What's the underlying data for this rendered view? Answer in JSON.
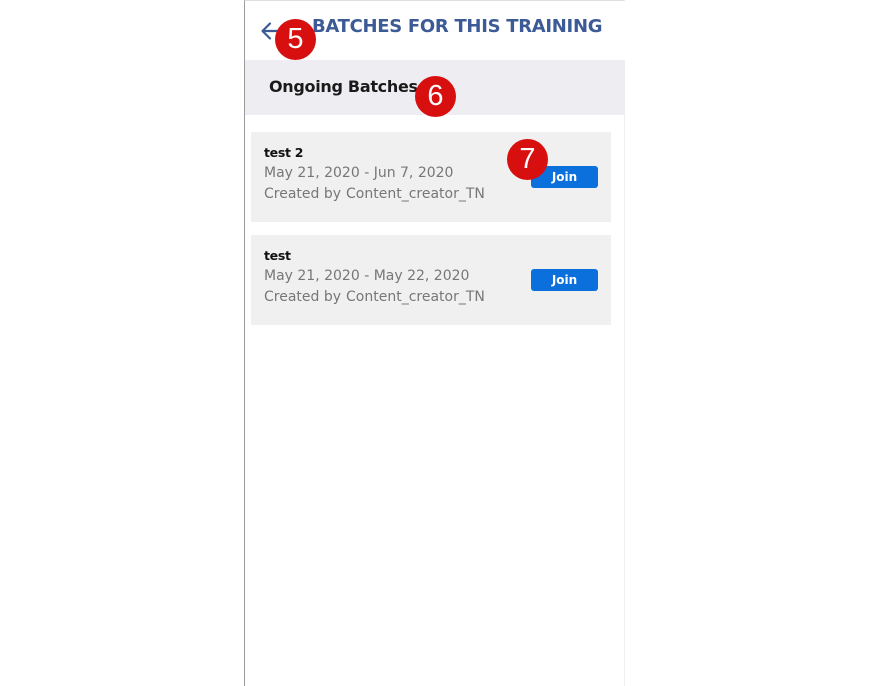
{
  "header": {
    "title": "BATCHES FOR THIS TRAINING",
    "back_icon": "arrow-left-icon"
  },
  "section": {
    "title": "Ongoing Batches"
  },
  "batches": [
    {
      "name": "test 2",
      "dates": "May 21, 2020 - Jun 7, 2020",
      "created_by_label": "Created by",
      "creator": "Content_creator_TN",
      "join_label": "Join"
    },
    {
      "name": "test",
      "dates": "May 21, 2020 - May 22, 2020",
      "created_by_label": "Created by",
      "creator": "Content_creator_TN",
      "join_label": "Join"
    }
  ],
  "markers": [
    "5",
    "6",
    "7"
  ],
  "colors": {
    "title": "#3c5a96",
    "section_background": "#eeeef2",
    "card_background": "#f0f0f0",
    "join_button": "#0b6fdc",
    "marker": "#d80f0f"
  }
}
